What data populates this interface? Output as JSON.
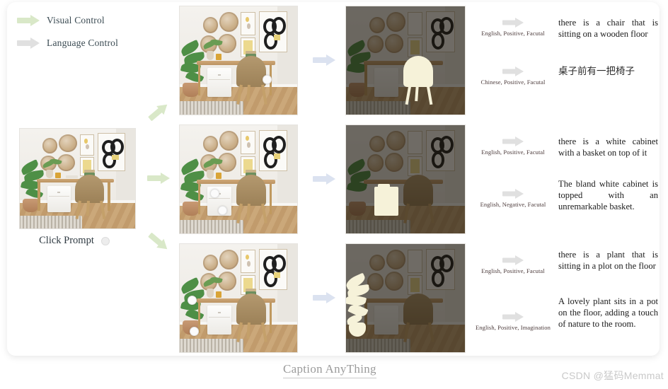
{
  "legend": {
    "items": [
      {
        "label": "Visual Control",
        "color": "#d9e8c8",
        "icon": "arrow-right-icon"
      },
      {
        "label": "Language Control",
        "color": "#e0e0e0",
        "icon": "arrow-right-icon"
      }
    ]
  },
  "input_panel": {
    "image_alt": "home-office-room-with-desk-chair-plant-cabinet",
    "click_prompt_label": "Click Prompt",
    "marker_icon": "click-point-dot"
  },
  "flow": {
    "visual_arrow_color": "#d9e8c8",
    "pipeline_arrow_color": "#dbe2f0",
    "language_arrow_color": "#e0e0e0"
  },
  "rows": [
    {
      "id": "row-chair",
      "original_alt": "room-with-click-point-on-chair",
      "segmented_alt": "room-with-chair-segmented-highlight",
      "segment_target": "chair",
      "captions": [
        {
          "tag": "English, Positive, Facutal",
          "text": "there is a chair that is sitting on a wooden floor",
          "lang": "en"
        },
        {
          "tag": "Chinese, Positive, Facutal",
          "text": "桌子前有一把椅子",
          "lang": "zh"
        }
      ]
    },
    {
      "id": "row-cabinet",
      "original_alt": "room-with-click-points-on-cabinet",
      "segmented_alt": "room-with-cabinet-segmented-highlight",
      "segment_target": "cabinet",
      "captions": [
        {
          "tag": "English, Positive, Facutal",
          "text": "there is a white cabinet with a basket on top of it",
          "lang": "en"
        },
        {
          "tag": "English, Negative, Facutal",
          "text": "The bland white cabinet is topped with an unremarkable basket.",
          "lang": "en"
        }
      ]
    },
    {
      "id": "row-plant",
      "original_alt": "room-with-click-points-on-plant",
      "segmented_alt": "room-with-plant-segmented-highlight",
      "segment_target": "plant",
      "captions": [
        {
          "tag": "English, Positive, Facutal",
          "text": "there is a plant that is sitting in a plot on the floor",
          "lang": "en"
        },
        {
          "tag": "English, Positive, Imagination",
          "text": "A lovely plant sits in a pot on the floor, adding a touch of nature to the room.",
          "lang": "en"
        }
      ]
    }
  ],
  "footer": {
    "title": "Caption AnyThing",
    "watermark": "CSDN @猛码Memmat"
  }
}
